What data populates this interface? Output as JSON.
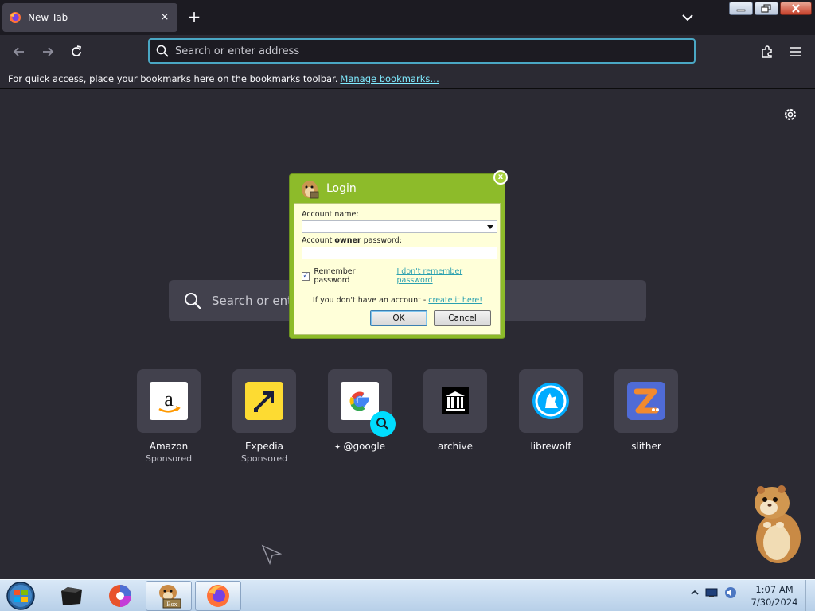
{
  "browser": {
    "tab_title": "New Tab",
    "tab_close": "×",
    "new_tab": "+",
    "urlbar_placeholder": "Search or enter address",
    "bookmarks_message": "For quick access, place your bookmarks here on the bookmarks toolbar.",
    "bookmarks_link": "Manage bookmarks…"
  },
  "newtab": {
    "search_placeholder": "Search or enter address",
    "tiles": [
      {
        "label": "Amazon",
        "sub": "Sponsored",
        "icon": "amazon-logo"
      },
      {
        "label": "Expedia",
        "sub": "Sponsored",
        "icon": "expedia-logo"
      },
      {
        "label": "@google",
        "sub": "",
        "icon": "google-logo"
      },
      {
        "label": "archive",
        "sub": "",
        "icon": "archive-logo"
      },
      {
        "label": "librewolf",
        "sub": "",
        "icon": "librewolf-logo"
      },
      {
        "label": "slither",
        "sub": "",
        "icon": "slither-logo"
      }
    ]
  },
  "dialog": {
    "title": "Login",
    "close": "x",
    "account_label": "Account name:",
    "password_label_pre": "Account ",
    "password_label_bold": "owner",
    "password_label_post": " password:",
    "remember_label": "Remember password",
    "forgot_link": "I don't remember password",
    "note_pre": "If you don't have an account - ",
    "note_link": "create it here!",
    "ok": "OK",
    "cancel": "Cancel"
  },
  "taskbar": {
    "time": "1:07 AM",
    "date": "7/30/2024",
    "box_label": "Box"
  },
  "colors": {
    "browser_bg": "#2b2a33",
    "accent": "#80ebff",
    "dialog_green": "#8dbb2a",
    "dialog_body": "#ffffd9"
  }
}
